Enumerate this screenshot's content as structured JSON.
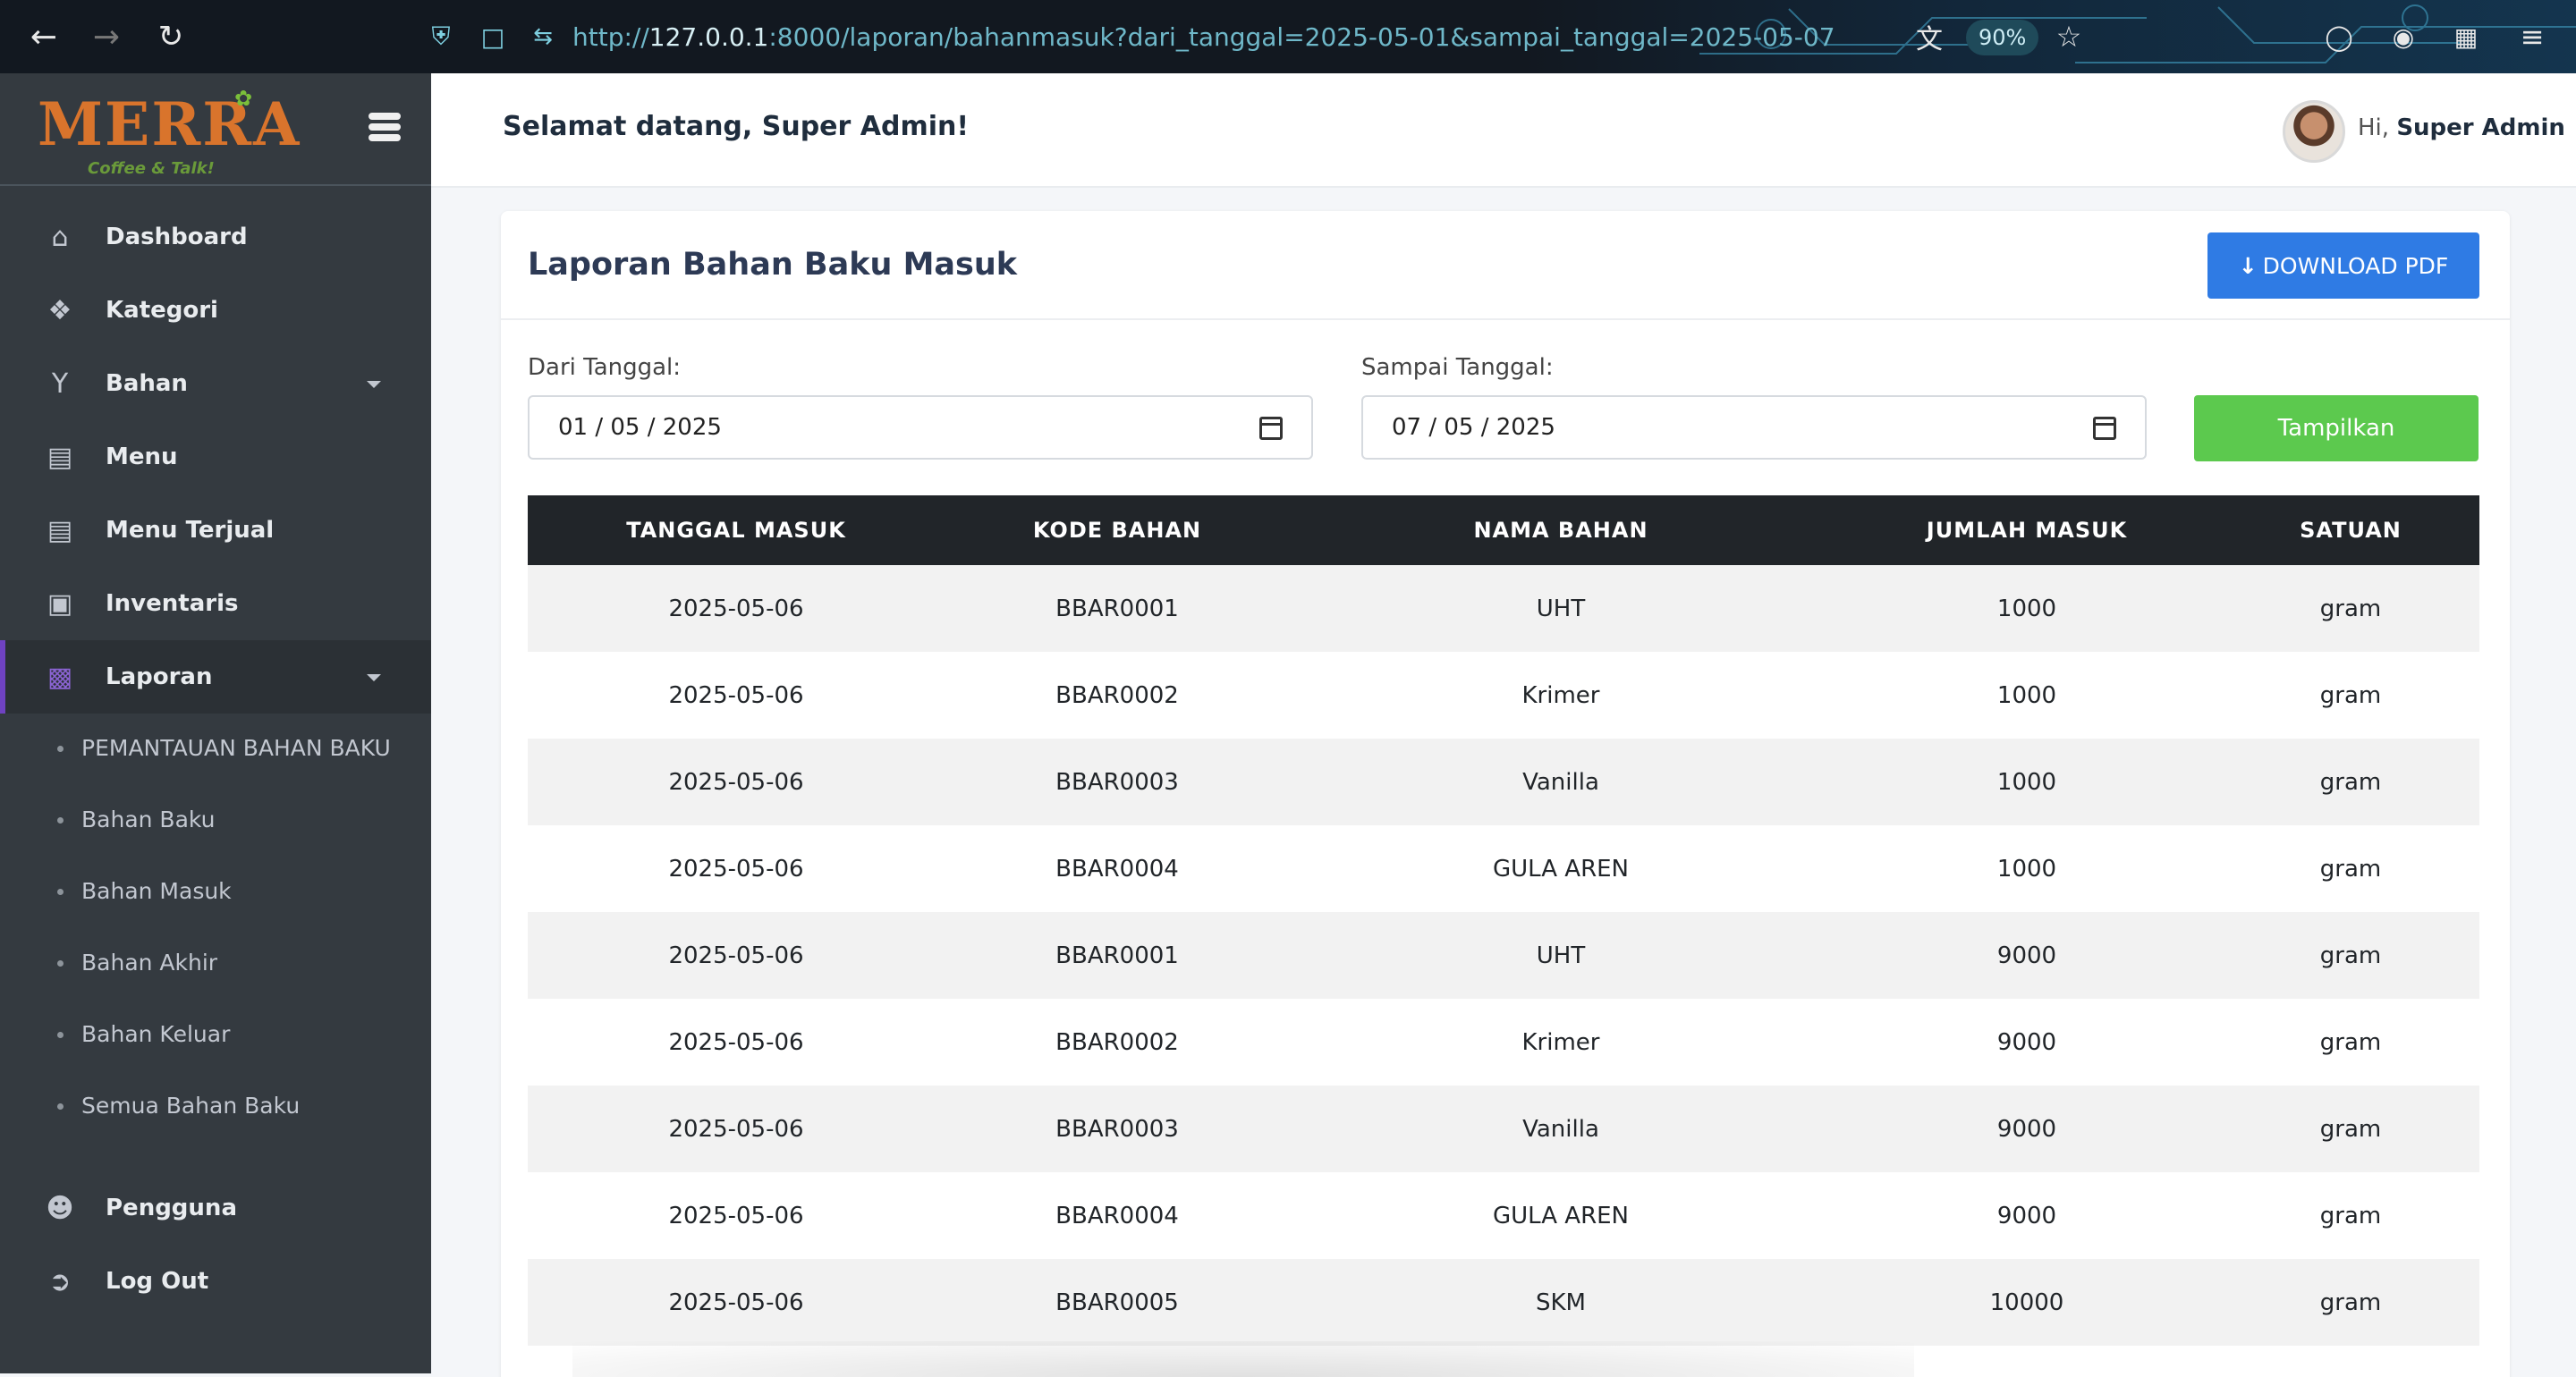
{
  "browser": {
    "url_scheme": "http://",
    "url_host": "127.0.0.1",
    "url_rest": ":8000/laporan/bahanmasuk?dari_tanggal=2025-05-01&sampai_tanggal=2025-05-07",
    "zoom": "90%"
  },
  "sidebar": {
    "logo": "MERRA",
    "logo_tagline": "Coffee & Talk!",
    "items": [
      {
        "label": "Dashboard",
        "icon": "home-icon"
      },
      {
        "label": "Kategori",
        "icon": "tags-icon"
      },
      {
        "label": "Bahan",
        "icon": "cocktail-icon"
      },
      {
        "label": "Menu",
        "icon": "receipt-icon"
      },
      {
        "label": "Menu Terjual",
        "icon": "receipt-icon"
      },
      {
        "label": "Inventaris",
        "icon": "box-icon"
      },
      {
        "label": "Laporan",
        "icon": "file-icon"
      }
    ],
    "sub_items": [
      "PEMANTAUAN BAHAN BAKU",
      "Bahan Baku",
      "Bahan Masuk",
      "Bahan Akhir",
      "Bahan Keluar",
      "Semua Bahan Baku"
    ],
    "bottom_items": [
      {
        "label": "Pengguna",
        "icon": "users-cog-icon"
      },
      {
        "label": "Log Out",
        "icon": "logout-icon"
      }
    ]
  },
  "header": {
    "welcome": "Selamat datang, Super Admin!",
    "greeting": "Hi,",
    "user_name": "Super Admin"
  },
  "report": {
    "title": "Laporan Bahan Baku Masuk",
    "download_label": "DOWNLOAD PDF",
    "from_label": "Dari Tanggal:",
    "from_value": "01 / 05 / 2025",
    "to_label": "Sampai Tanggal:",
    "to_value": "07 / 05 / 2025",
    "show_label": "Tampilkan",
    "columns": [
      "TANGGAL MASUK",
      "KODE BAHAN",
      "NAMA BAHAN",
      "JUMLAH MASUK",
      "SATUAN"
    ],
    "rows": [
      [
        "2025-05-06",
        "BBAR0001",
        "UHT",
        "1000",
        "gram"
      ],
      [
        "2025-05-06",
        "BBAR0002",
        "Krimer",
        "1000",
        "gram"
      ],
      [
        "2025-05-06",
        "BBAR0003",
        "Vanilla",
        "1000",
        "gram"
      ],
      [
        "2025-05-06",
        "BBAR0004",
        "GULA AREN",
        "1000",
        "gram"
      ],
      [
        "2025-05-06",
        "BBAR0001",
        "UHT",
        "9000",
        "gram"
      ],
      [
        "2025-05-06",
        "BBAR0002",
        "Krimer",
        "9000",
        "gram"
      ],
      [
        "2025-05-06",
        "BBAR0003",
        "Vanilla",
        "9000",
        "gram"
      ],
      [
        "2025-05-06",
        "BBAR0004",
        "GULA AREN",
        "9000",
        "gram"
      ],
      [
        "2025-05-06",
        "BBAR0005",
        "SKM",
        "10000",
        "gram"
      ]
    ]
  },
  "colors": {
    "sidebar_bg": "#343a40",
    "active_accent": "#6f42c1",
    "pdf_button": "#2f7be4",
    "show_button": "#5cc94e",
    "table_header": "#212529"
  }
}
